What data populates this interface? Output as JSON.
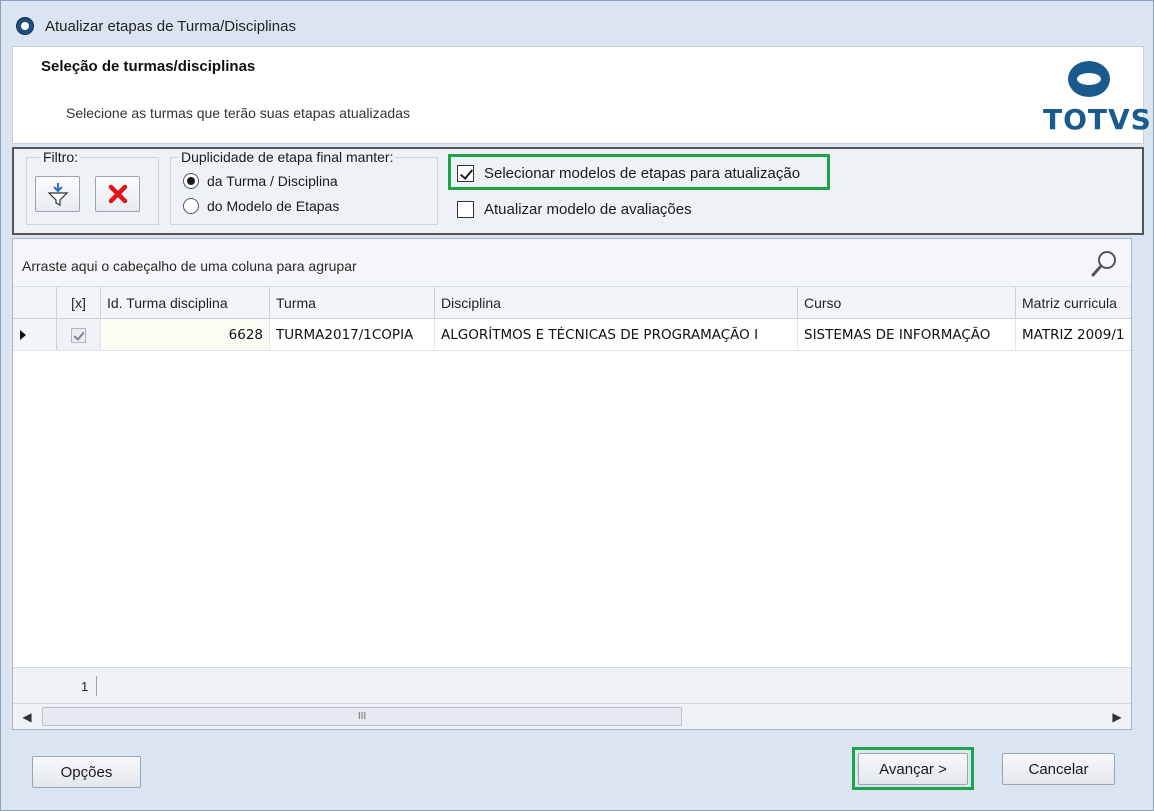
{
  "window": {
    "title": "Atualizar etapas de Turma/Disciplinas"
  },
  "header": {
    "title": "Seleção de turmas/disciplinas",
    "subtitle": "Selecione as turmas que terão suas etapas atualizadas",
    "logo_text": "TOTVS"
  },
  "filter": {
    "legend": "Filtro:",
    "apply_icon": "filter-icon",
    "clear_icon": "red-x-icon"
  },
  "duplicity": {
    "legend": "Duplicidade de etapa final manter:",
    "options": [
      {
        "label": "da Turma / Disciplina",
        "selected": true
      },
      {
        "label": "do Modelo de Etapas",
        "selected": false
      }
    ]
  },
  "options": {
    "select_models_label": "Selecionar modelos de etapas para atualização",
    "select_models_checked": true,
    "update_assessment_label": "Atualizar modelo de avaliações",
    "update_assessment_checked": false
  },
  "grid": {
    "group_hint": "Arraste aqui o cabeçalho de uma coluna para agrupar",
    "columns": [
      "[x]",
      "Id. Turma disciplina",
      "Turma",
      "Disciplina",
      "Curso",
      "Matriz curricula"
    ],
    "rows": [
      {
        "checked": true,
        "id": "6628",
        "turma": "TURMA2017/1COPIA",
        "disciplina": "ALGORÍTMOS E TÉCNICAS DE PROGRAMAÇÃO I",
        "curso": "SISTEMAS DE INFORMAÇÃO",
        "matriz": "MATRIZ 2009/1"
      }
    ],
    "row_count": "1",
    "scroll_thumb": "III"
  },
  "buttons": {
    "options": "Opções",
    "next": "Avançar >",
    "cancel": "Cancelar"
  },
  "colors": {
    "highlight": "#1fa34a",
    "brand": "#1b5a8c"
  }
}
